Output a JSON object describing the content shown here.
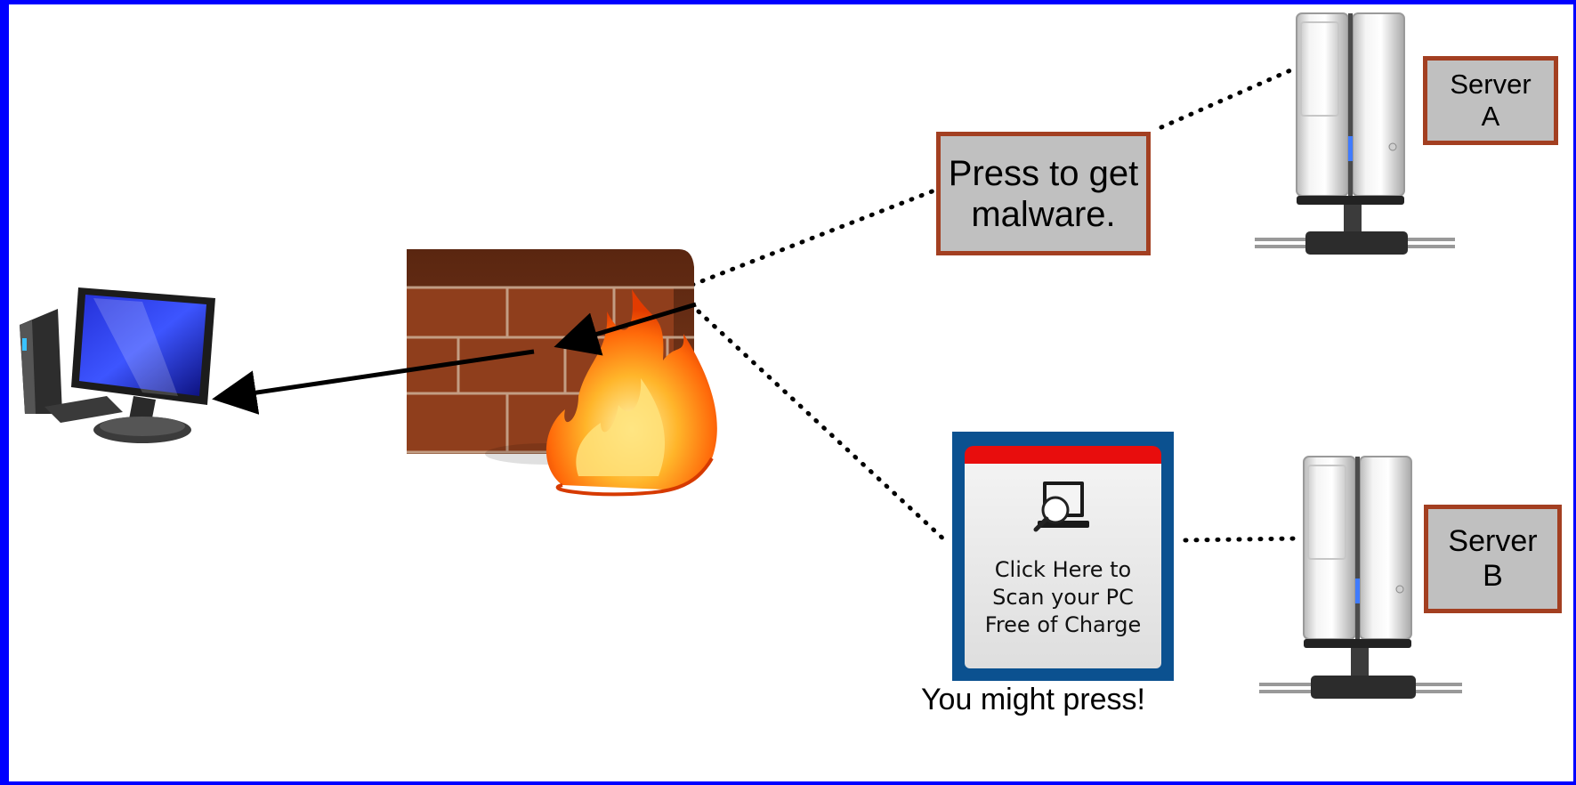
{
  "labels": {
    "press_box": "Press to get\nmalware.",
    "server_a": "Server\nA",
    "server_b": "Server\nB",
    "popup": "Click Here to\nScan your PC\nFree of Charge",
    "you_might_press": "You might press!"
  },
  "colors": {
    "frame": "#0000ff",
    "label_border": "#a33f21",
    "label_fill": "#c0c0c0",
    "popup_frame": "#0b5190",
    "popup_bar": "#e80d0d"
  },
  "icons": [
    "desktop-computer-icon",
    "firewall-icon",
    "fire-icon",
    "server-tower-icon",
    "scanner-computer-icon"
  ]
}
